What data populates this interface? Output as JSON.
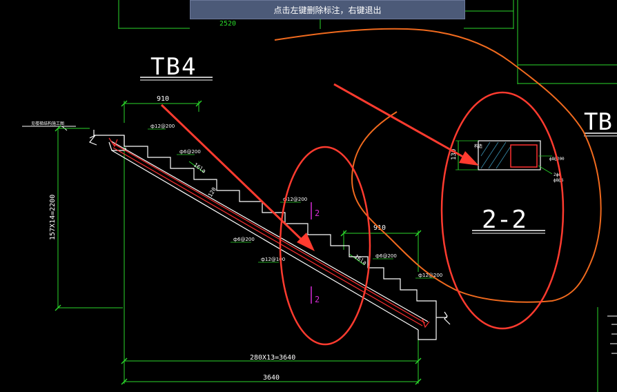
{
  "status_tip": "点击左键删除标注，右键退出",
  "colors": {
    "background": "#000000",
    "dimension": "#2bd92b",
    "stair_outline": "#ffffff",
    "rebar": "#ff3030",
    "annotation_red": "#ff3b2f",
    "annotation_orange": "#f06a1e",
    "section_mark": "#d62bd6"
  },
  "drawing": {
    "title_tb4": "TB4",
    "title_tb_partial": "TB",
    "section_title": "2-2",
    "top_dim": "2520",
    "dim_910_left": "910",
    "dim_910_right": "910",
    "dim_bottom_inner": "280X13=3640",
    "dim_bottom_outer": "3640",
    "dim_vertical": "157X14=2200",
    "thickness": "120",
    "section_height": "130",
    "left_note": "见楼梯结构施工图",
    "rebar_labels": {
      "a": "ф12@200",
      "b": "ф6@200",
      "c": "ф12@200",
      "d": "ф6@200",
      "e": "ф12@100",
      "f": "ф6@200",
      "g": "ф12@200",
      "h": "ф8@200",
      "i": "2ф6",
      "j": "ф8@6",
      "k": "构造"
    },
    "anchor_len_1": "16la",
    "anchor_len_2": "16la",
    "section_mark_1": "2",
    "section_mark_2": "2"
  }
}
